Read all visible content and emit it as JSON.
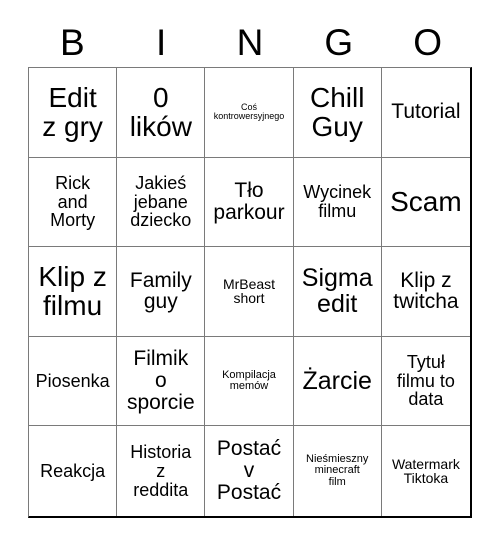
{
  "card": {
    "header_letters": [
      "B",
      "I",
      "N",
      "G",
      "O"
    ],
    "rows": [
      [
        {
          "text": "Edit\nz gry",
          "size": "s-xl"
        },
        {
          "text": "0\nlików",
          "size": "s-xl"
        },
        {
          "text": "Coś\nkontrowersyjnego",
          "size": "s-tiny"
        },
        {
          "text": "Chill\nGuy",
          "size": "s-xl"
        },
        {
          "text": "Tutorial",
          "size": "s-md"
        }
      ],
      [
        {
          "text": "Rick\nand\nMorty",
          "size": "s-sm"
        },
        {
          "text": "Jakieś\njebane\ndziecko",
          "size": "s-sm"
        },
        {
          "text": "Tło\nparkour",
          "size": "s-md"
        },
        {
          "text": "Wycinek\nfilmu",
          "size": "s-sm"
        },
        {
          "text": "Scam",
          "size": "s-xl"
        }
      ],
      [
        {
          "text": "Klip z\nfilmu",
          "size": "s-xl"
        },
        {
          "text": "Family\nguy",
          "size": "s-md"
        },
        {
          "text": "MrBeast\nshort",
          "size": "s-xs"
        },
        {
          "text": "Sigma\nedit",
          "size": "s-lg"
        },
        {
          "text": "Klip z\ntwitcha",
          "size": "s-md"
        }
      ],
      [
        {
          "text": "Piosenka",
          "size": "s-sm"
        },
        {
          "text": "Filmik\no\nsporcie",
          "size": "s-md"
        },
        {
          "text": "Kompilacja\nmemów",
          "size": "s-xxs"
        },
        {
          "text": "Żarcie",
          "size": "s-lg"
        },
        {
          "text": "Tytuł\nfilmu to\ndata",
          "size": "s-sm"
        }
      ],
      [
        {
          "text": "Reakcja",
          "size": "s-sm"
        },
        {
          "text": "Historia\nz\nreddita",
          "size": "s-sm"
        },
        {
          "text": "Postać\nv\nPostać",
          "size": "s-md"
        },
        {
          "text": "Nieśmieszny\nminecraft\nfilm",
          "size": "s-xxs"
        },
        {
          "text": "Watermark\nTiktoka",
          "size": "s-xs"
        }
      ]
    ]
  }
}
